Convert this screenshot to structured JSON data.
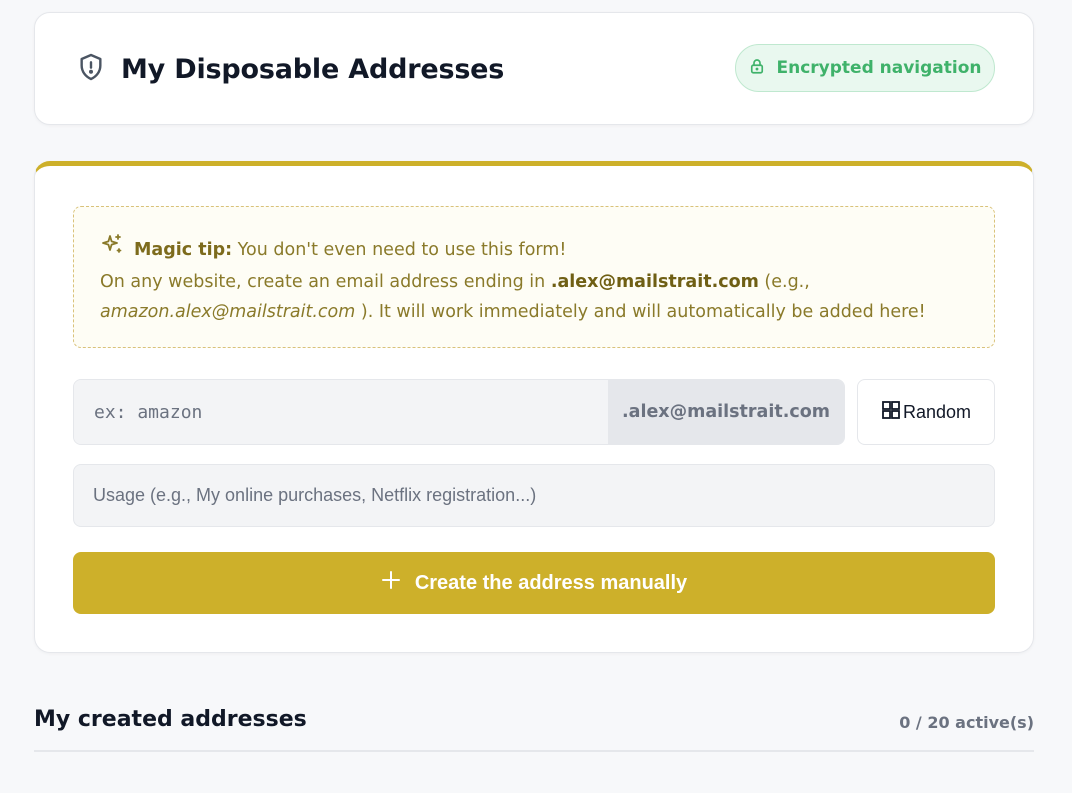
{
  "header": {
    "title": "My Disposable Addresses",
    "title_icon": "shield-alert-icon",
    "badge_label": "Encrypted navigation",
    "badge_icon": "lock-icon"
  },
  "tip": {
    "icon": "sparkles-icon",
    "label": "Magic tip:",
    "line1": " You don't even need to use this form!",
    "line2_prefix": "On any website, create an email address ending in ",
    "email_suffix": ".alex@mailstrait.com",
    "line2_after": " (e.g.,",
    "example": "amazon.alex@mailstrait.com",
    "line3_after": " ). It will work immediately and will automatically be added here!"
  },
  "form": {
    "prefix_placeholder": "ex: amazon",
    "prefix_value": "",
    "suffix": ".alex@mailstrait.com",
    "random_label": "Random",
    "random_icon": "grid-icon",
    "usage_placeholder": "Usage (e.g., My online purchases, Netflix registration...)",
    "usage_value": "",
    "create_label": "Create the address manually",
    "create_icon": "plus-icon"
  },
  "addresses": {
    "title": "My created addresses",
    "count": "0 / 20 active(s)"
  },
  "colors": {
    "accent": "#cdb02a",
    "badge_green": "#3fb26a",
    "tip_text": "#8a7a2a"
  }
}
